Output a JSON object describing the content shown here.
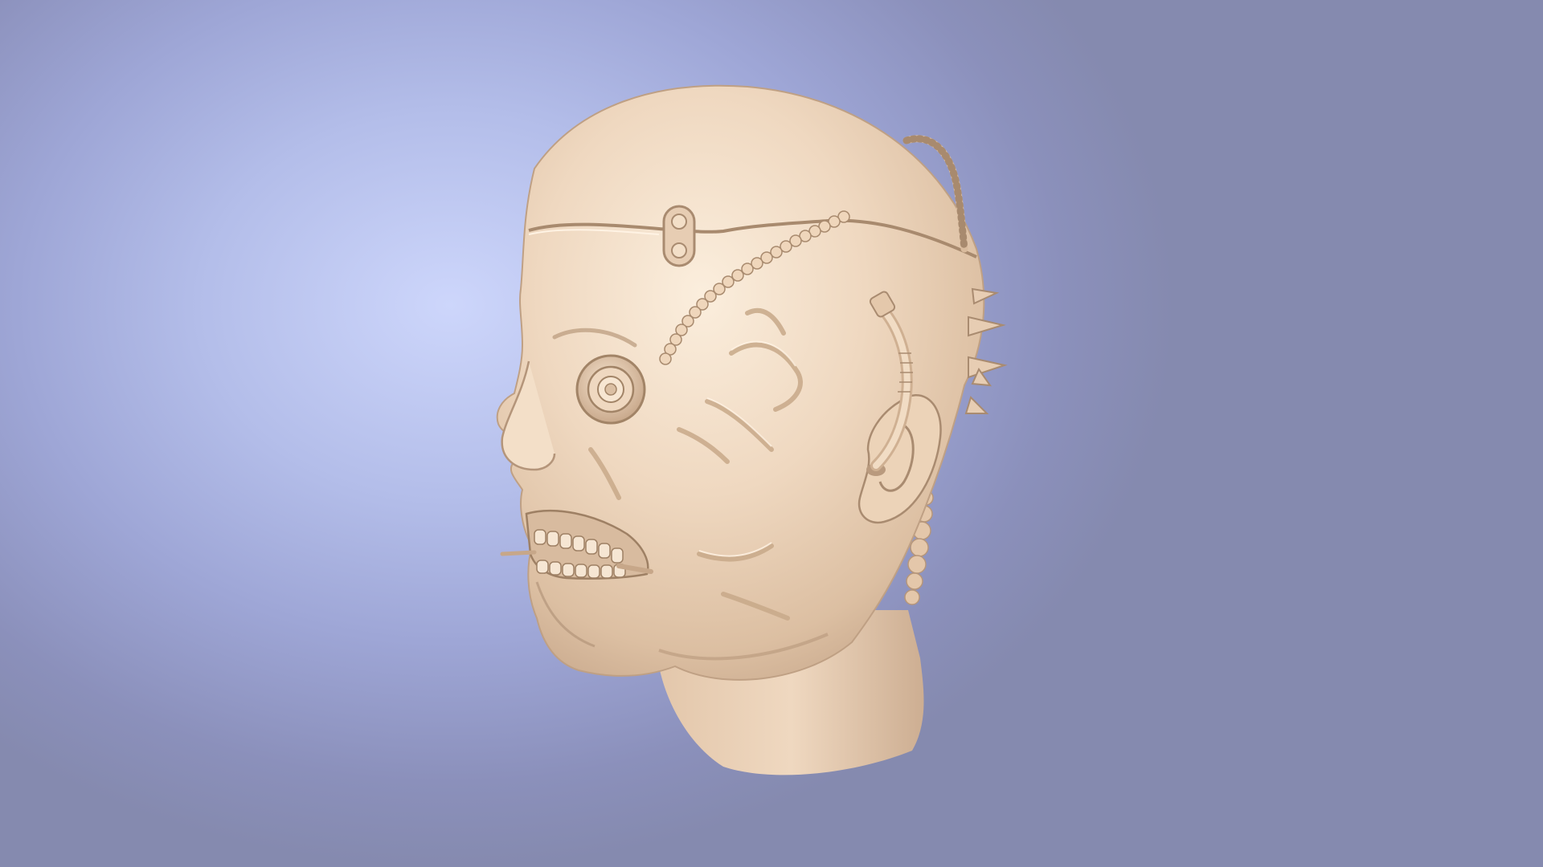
{
  "scene": {
    "background_colors": [
      "#cdd6fb",
      "#b3bde9",
      "#9ea6d6",
      "#858aaf"
    ],
    "model_color": "#efd8c0",
    "model_shadow_color": "#c4a488",
    "model_highlight_color": "#fbeedd",
    "subject": "cyborg-head-sculpt"
  }
}
